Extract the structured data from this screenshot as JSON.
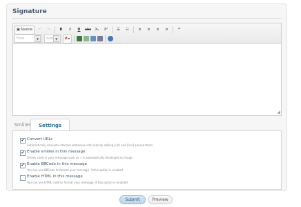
{
  "section_title": "Signature",
  "toolbar": {
    "source_label": "Source",
    "undo": "↶",
    "redo": "↷",
    "bold": "B",
    "italic": "I",
    "underline": "U",
    "strike": "abc",
    "subscript": "X₂",
    "superscript": "X²",
    "bulleted_list": "☰",
    "numbered_list": "☷",
    "align_left": "≡",
    "align_center": "≡",
    "align_right": "≡",
    "justify": "≡",
    "quote": "❞",
    "font_placeholder": "Font",
    "size_placeholder": "Size",
    "text_color": "A",
    "icon_colors": {
      "link": "#3b7a3b",
      "unlink": "#6a9a6a",
      "image": "#6b8fb8",
      "table": "#7a7a9a",
      "help": "#3f78b5"
    }
  },
  "tabs": {
    "smilies": "Smilies",
    "settings": "Settings"
  },
  "options": [
    {
      "label": "Convert URLs",
      "description": "Automatically converts internet addresses into links by adding [url] and [/url] around them.",
      "checked": true
    },
    {
      "label": "Enable smilies in this message",
      "description": "Smiley code in your message such as :) is automatically displayed as image.",
      "checked": true
    },
    {
      "label": "Enable BBCode in this message",
      "description": "You can use BBCode to format your message, if this option is enabled.",
      "checked": true
    },
    {
      "label": "Enable HTML in this message",
      "description": "You can use HTML code to format your message, if this option is enabled.",
      "checked": false
    }
  ],
  "buttons": {
    "submit": "Submit",
    "preview": "Preview"
  },
  "check_mark": "✔"
}
